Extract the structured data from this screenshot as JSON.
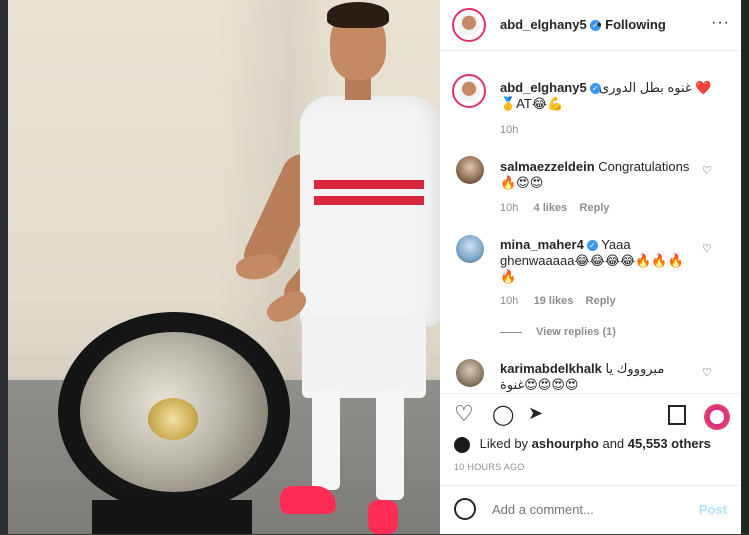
{
  "post": {
    "author": "abd_elghany5",
    "following_label": "• Following",
    "more_icon": "···",
    "caption_text": "غنوه بطل الدورى ❤️",
    "caption_line2": "🥇AT😂💪",
    "caption_time": "10h"
  },
  "comments": [
    {
      "user": "salmaezzeldein",
      "text": "Congratulations",
      "text2": "🔥😍😍",
      "time": "10h",
      "likes": "4 likes",
      "reply": "Reply"
    },
    {
      "user": "mina_maher4",
      "verified": true,
      "text": "Yaaa",
      "text2": "ghenwaaaaa😂😂😂😂🔥🔥🔥",
      "text3": "🔥",
      "time": "10h",
      "likes": "19 likes",
      "reply": "Reply",
      "view_replies": "View replies (1)"
    },
    {
      "user": "karimabdelkhalk",
      "text": "مبروووك يا",
      "text2": "غنوة😍😍😍😍",
      "time": ""
    }
  ],
  "actions": {
    "like_icon": "♡",
    "comment_icon": "◯",
    "share_icon": "➤",
    "save_icon": "🔖"
  },
  "likes_summary": {
    "prefix": "Liked by",
    "user": "ashourpho",
    "middle": "and",
    "count": "45,553 others"
  },
  "time_ago": "10 HOURS AGO",
  "add_comment": {
    "placeholder": "Add a comment...",
    "post_label": "Post"
  },
  "colors": {
    "accent": "#3897f0",
    "post_disabled": "#b2dffc",
    "story_ring": "#e1306c",
    "jersey_stripe": "#d7263d",
    "boots": "#ff2d55"
  }
}
